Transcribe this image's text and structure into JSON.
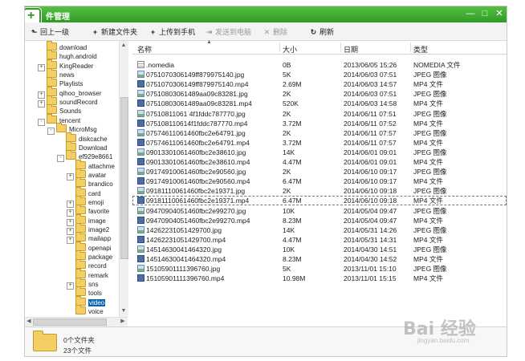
{
  "window": {
    "title": "件管理",
    "controls": {
      "minimize": "—",
      "maximize": "□",
      "close": "✕"
    }
  },
  "toolbar": {
    "up": {
      "label": "回上一级",
      "icon": "arrow-up-icon"
    },
    "new_folder": {
      "label": "新建文件夹",
      "icon": "plus-icon"
    },
    "upload": {
      "label": "上传到手机",
      "icon": "plus-icon"
    },
    "send_pc": {
      "label": "发送到电脑",
      "icon": "send-icon"
    },
    "delete": {
      "label": "删除",
      "icon": "close-icon"
    },
    "refresh": {
      "label": "刷新",
      "icon": "refresh-icon"
    }
  },
  "tree": [
    {
      "label": "download",
      "depth": 0,
      "expand": ""
    },
    {
      "label": "hugh.android",
      "depth": 0,
      "expand": ""
    },
    {
      "label": "KingReader",
      "depth": 0,
      "expand": "+"
    },
    {
      "label": "news",
      "depth": 0,
      "expand": ""
    },
    {
      "label": "Playlists",
      "depth": 0,
      "expand": ""
    },
    {
      "label": "qihoo_browser",
      "depth": 0,
      "expand": "+"
    },
    {
      "label": "soundRecord",
      "depth": 0,
      "expand": "+"
    },
    {
      "label": "Sounds",
      "depth": 0,
      "expand": ""
    },
    {
      "label": "tencent",
      "depth": 0,
      "expand": "-"
    },
    {
      "label": "MicroMsg",
      "depth": 1,
      "expand": "-"
    },
    {
      "label": "diskcache",
      "depth": 2,
      "expand": ""
    },
    {
      "label": "Download",
      "depth": 2,
      "expand": ""
    },
    {
      "label": "ef929e8661",
      "depth": 2,
      "expand": "-"
    },
    {
      "label": "attachme",
      "depth": 3,
      "expand": ""
    },
    {
      "label": "avatar",
      "depth": 3,
      "expand": "+"
    },
    {
      "label": "brandico",
      "depth": 3,
      "expand": ""
    },
    {
      "label": "card",
      "depth": 3,
      "expand": ""
    },
    {
      "label": "emoji",
      "depth": 3,
      "expand": "+"
    },
    {
      "label": "favorite",
      "depth": 3,
      "expand": "+"
    },
    {
      "label": "image",
      "depth": 3,
      "expand": "+"
    },
    {
      "label": "image2",
      "depth": 3,
      "expand": "+"
    },
    {
      "label": "mailapp",
      "depth": 3,
      "expand": "+"
    },
    {
      "label": "openapi",
      "depth": 3,
      "expand": ""
    },
    {
      "label": "package",
      "depth": 3,
      "expand": ""
    },
    {
      "label": "record",
      "depth": 3,
      "expand": ""
    },
    {
      "label": "remark",
      "depth": 3,
      "expand": ""
    },
    {
      "label": "sns",
      "depth": 3,
      "expand": "+"
    },
    {
      "label": "tools",
      "depth": 3,
      "expand": ""
    },
    {
      "label": "video",
      "depth": 3,
      "expand": "",
      "selected": true
    },
    {
      "label": "voice",
      "depth": 3,
      "expand": ""
    }
  ],
  "columns": {
    "name": "名称",
    "size": "大小",
    "date": "日期",
    "type": "类型"
  },
  "files": [
    {
      "name": ".nomedia",
      "size": "0B",
      "date": "2013/06/05 15:26",
      "type": "NOMEDIA 文件",
      "kind": "doc"
    },
    {
      "name": "0751070306149ff879975140.jpg",
      "size": "5K",
      "date": "2014/06/03 07:51",
      "type": "JPEG 图像",
      "kind": "img"
    },
    {
      "name": "0751070306149ff879975140.mp4",
      "size": "2.69M",
      "date": "2014/06/03 14:57",
      "type": "MP4 文件",
      "kind": "vid"
    },
    {
      "name": "07510803061489aa09c83281.jpg",
      "size": "2K",
      "date": "2014/06/03 07:51",
      "type": "JPEG 图像",
      "kind": "img"
    },
    {
      "name": "07510803061489aa09c83281.mp4",
      "size": "520K",
      "date": "2014/06/03 14:58",
      "type": "MP4 文件",
      "kind": "vid"
    },
    {
      "name": "07510811061 4f1fddc787770.jpg",
      "size": "2K",
      "date": "2014/06/11 07:51",
      "type": "JPEG 图像",
      "kind": "img"
    },
    {
      "name": "075108110614f1fddc787770.mp4",
      "size": "3.72M",
      "date": "2014/06/11 07:52",
      "type": "MP4 文件",
      "kind": "vid"
    },
    {
      "name": "07574611061460fbc2e64791.jpg",
      "size": "2K",
      "date": "2014/06/11 07:57",
      "type": "JPEG 图像",
      "kind": "img"
    },
    {
      "name": "07574611061460fbc2e64791.mp4",
      "size": "3.72M",
      "date": "2014/06/11 07:57",
      "type": "MP4 文件",
      "kind": "vid"
    },
    {
      "name": "09013301061460fbc2e38610.jpg",
      "size": "14K",
      "date": "2014/06/01 09:01",
      "type": "JPEG 图像",
      "kind": "img"
    },
    {
      "name": "09013301061460fbc2e38610.mp4",
      "size": "4.47M",
      "date": "2014/06/01 09:01",
      "type": "MP4 文件",
      "kind": "vid"
    },
    {
      "name": "09174910061460fbc2e90560.jpg",
      "size": "2K",
      "date": "2014/06/10 09:17",
      "type": "JPEG 图像",
      "kind": "img"
    },
    {
      "name": "09174910061460fbc2e90560.mp4",
      "size": "6.47M",
      "date": "2014/06/10 09:17",
      "type": "MP4 文件",
      "kind": "vid"
    },
    {
      "name": "09181110061460fbc2e19371.jpg",
      "size": "2K",
      "date": "2014/06/10 09:18",
      "type": "JPEG 图像",
      "kind": "img"
    },
    {
      "name": "09181110061460fbc2e19371.mp4",
      "size": "6.47M",
      "date": "2014/06/10 09:18",
      "type": "MP4 文件",
      "kind": "vid",
      "focused": true
    },
    {
      "name": "09470904051460fbc2e99270.jpg",
      "size": "10K",
      "date": "2014/05/04 09:47",
      "type": "JPEG 图像",
      "kind": "img"
    },
    {
      "name": "09470904051460fbc2e99270.mp4",
      "size": "8.23M",
      "date": "2014/05/04 09:47",
      "type": "MP4 文件",
      "kind": "vid"
    },
    {
      "name": "14262231051429700.jpg",
      "size": "14K",
      "date": "2014/05/31 14:26",
      "type": "JPEG 图像",
      "kind": "img"
    },
    {
      "name": "14262231051429700.mp4",
      "size": "4.47M",
      "date": "2014/05/31 14:31",
      "type": "MP4 文件",
      "kind": "vid"
    },
    {
      "name": "14514630041464320.jpg",
      "size": "10K",
      "date": "2014/04/30 14:51",
      "type": "JPEG 图像",
      "kind": "img"
    },
    {
      "name": "14514630041464320.mp4",
      "size": "8.23M",
      "date": "2014/04/30 14:52",
      "type": "MP4 文件",
      "kind": "vid"
    },
    {
      "name": "15105901111396760.jpg",
      "size": "5K",
      "date": "2013/11/01 15:10",
      "type": "JPEG 图像",
      "kind": "img"
    },
    {
      "name": "15105901111396760.mp4",
      "size": "10.98M",
      "date": "2013/11/01 15:15",
      "type": "MP4 文件",
      "kind": "vid"
    }
  ],
  "status": {
    "folders": "0个文件夹",
    "files": "23个文件"
  },
  "watermark": {
    "brand": "Bai 经验",
    "url": "jingyan.baidu.com"
  }
}
